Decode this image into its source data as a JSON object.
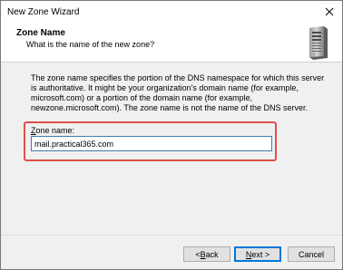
{
  "window": {
    "title": "New Zone Wizard"
  },
  "header": {
    "title": "Zone Name",
    "subtitle": "What is the name of the new zone?"
  },
  "body": {
    "description": "The zone name specifies the portion of the DNS namespace for which this server is authoritative. It might be your organization's domain name (for example, microsoft.com) or a portion of the domain name (for example, newzone.microsoft.com). The zone name is not the name of the DNS server.",
    "zone_label_accel": "Z",
    "zone_label_rest": "one name:",
    "zone_value": "mail.practical365.com"
  },
  "buttons": {
    "back_accel": "B",
    "back_prefix": "< ",
    "back_rest": "ack",
    "next_accel": "N",
    "next_rest": "ext >",
    "cancel": "Cancel"
  },
  "icons": {
    "close": "close-icon",
    "server": "server-icon"
  },
  "colors": {
    "highlight": "#e0504b",
    "input_border": "#3c7fb1",
    "primary_border": "#0078d7"
  }
}
